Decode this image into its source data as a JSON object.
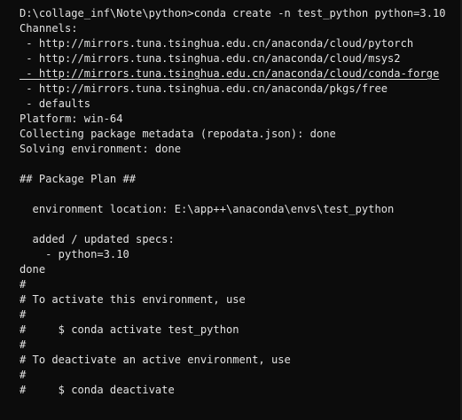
{
  "terminal": {
    "lines": [
      "D:\\collage_inf\\Note\\python>conda create -n test_python python=3.10",
      "Channels:",
      " - http://mirrors.tuna.tsinghua.edu.cn/anaconda/cloud/pytorch",
      " - http://mirrors.tuna.tsinghua.edu.cn/anaconda/cloud/msys2",
      " - http://mirrors.tuna.tsinghua.edu.cn/anaconda/cloud/conda-forge",
      " - http://mirrors.tuna.tsinghua.edu.cn/anaconda/pkgs/free",
      " - defaults",
      "Platform: win-64",
      "Collecting package metadata (repodata.json): done",
      "Solving environment: done",
      "",
      "## Package Plan ##",
      "",
      "  environment location: E:\\app++\\anaconda\\envs\\test_python",
      "",
      "  added / updated specs:",
      "    - python=3.10",
      "done",
      "#",
      "# To activate this environment, use",
      "#",
      "#     $ conda activate test_python",
      "#",
      "# To deactivate an active environment, use",
      "#",
      "#     $ conda deactivate"
    ]
  }
}
